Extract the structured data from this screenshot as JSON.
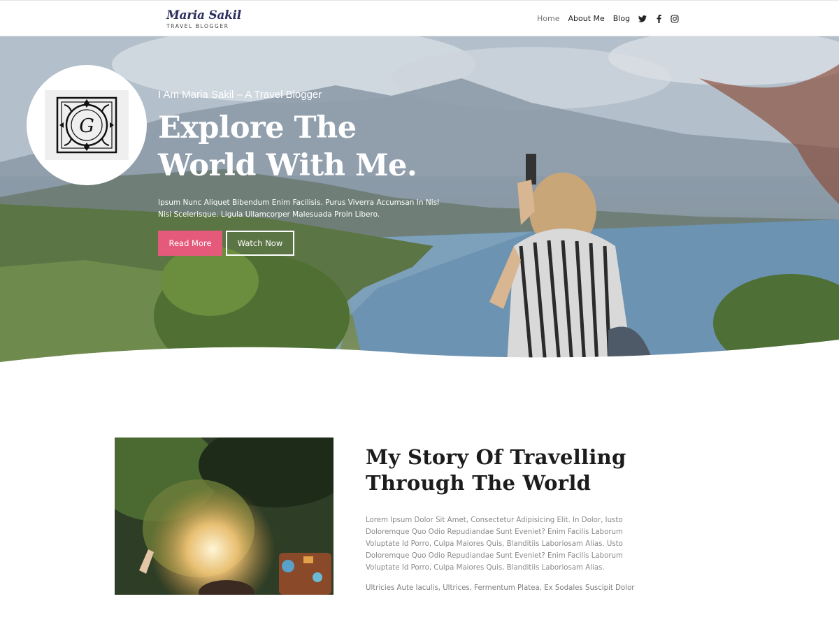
{
  "header": {
    "logo_script": "Maria Sakil",
    "logo_tagline": "TRAVEL BLOGGER",
    "nav": [
      {
        "label": "Home"
      },
      {
        "label": "About Me"
      },
      {
        "label": "Blog"
      }
    ],
    "social_icons": [
      "twitter-icon",
      "facebook-icon",
      "instagram-icon"
    ]
  },
  "hero": {
    "subtitle": "I Am Maria Sakil – A Travel Blogger",
    "title": "Explore The World With Me.",
    "text": "Ipsum Nunc Aliquet Bibendum Enim Facilisis. Purus Viverra Accumsan In Nisl Nisi Scelerisque. Ligula Ullamcorper Malesuada Proin Libero.",
    "primary_button": "Read More",
    "secondary_button": "Watch Now",
    "badge_letter": "G"
  },
  "story": {
    "title": "My Story Of Travelling Through The World",
    "paragraph": "Lorem Ipsum Dolor Sit Amet, Consectetur Adipisicing Elit. In Dolor, Iusto Doloremque Quo Odio Repudiandae Sunt Eveniet? Enim Facilis Laborum Voluptate Id Porro, Culpa Maiores Quis, Blanditiis Laboriosam Alias. Usto Doloremque Quo Odio Repudiandae Sunt Eveniet? Enim Facilis Laborum Voluptate Id Porro, Culpa Maiores Quis, Blanditiis Laboriosam Alias.",
    "paragraph_2": "Ultricies Aute Iaculis, Ultrices, Fermentum Platea, Ex Sodales Suscipit Dolor"
  },
  "colors": {
    "accent": "#e55a7b",
    "brand_logo": "#2d2f5e",
    "body_text": "#8a8a8a"
  }
}
